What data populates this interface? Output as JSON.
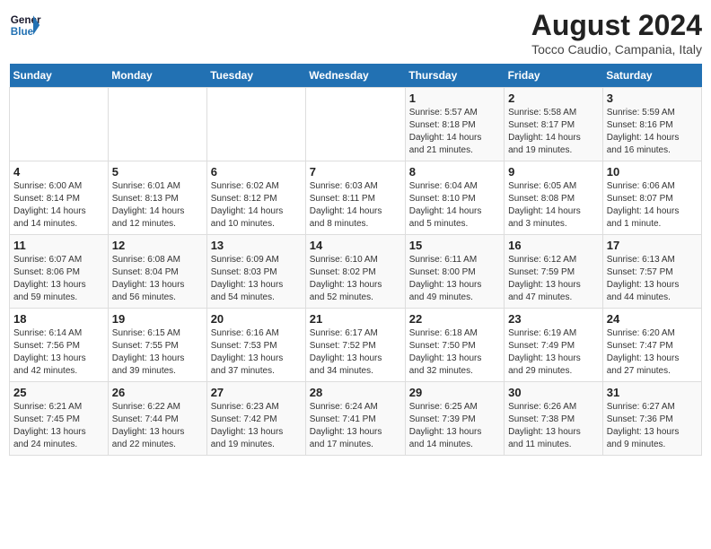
{
  "header": {
    "logo_line1": "General",
    "logo_line2": "Blue",
    "month": "August 2024",
    "location": "Tocco Caudio, Campania, Italy"
  },
  "weekdays": [
    "Sunday",
    "Monday",
    "Tuesday",
    "Wednesday",
    "Thursday",
    "Friday",
    "Saturday"
  ],
  "weeks": [
    [
      {
        "day": "",
        "info": ""
      },
      {
        "day": "",
        "info": ""
      },
      {
        "day": "",
        "info": ""
      },
      {
        "day": "",
        "info": ""
      },
      {
        "day": "1",
        "info": "Sunrise: 5:57 AM\nSunset: 8:18 PM\nDaylight: 14 hours\nand 21 minutes."
      },
      {
        "day": "2",
        "info": "Sunrise: 5:58 AM\nSunset: 8:17 PM\nDaylight: 14 hours\nand 19 minutes."
      },
      {
        "day": "3",
        "info": "Sunrise: 5:59 AM\nSunset: 8:16 PM\nDaylight: 14 hours\nand 16 minutes."
      }
    ],
    [
      {
        "day": "4",
        "info": "Sunrise: 6:00 AM\nSunset: 8:14 PM\nDaylight: 14 hours\nand 14 minutes."
      },
      {
        "day": "5",
        "info": "Sunrise: 6:01 AM\nSunset: 8:13 PM\nDaylight: 14 hours\nand 12 minutes."
      },
      {
        "day": "6",
        "info": "Sunrise: 6:02 AM\nSunset: 8:12 PM\nDaylight: 14 hours\nand 10 minutes."
      },
      {
        "day": "7",
        "info": "Sunrise: 6:03 AM\nSunset: 8:11 PM\nDaylight: 14 hours\nand 8 minutes."
      },
      {
        "day": "8",
        "info": "Sunrise: 6:04 AM\nSunset: 8:10 PM\nDaylight: 14 hours\nand 5 minutes."
      },
      {
        "day": "9",
        "info": "Sunrise: 6:05 AM\nSunset: 8:08 PM\nDaylight: 14 hours\nand 3 minutes."
      },
      {
        "day": "10",
        "info": "Sunrise: 6:06 AM\nSunset: 8:07 PM\nDaylight: 14 hours\nand 1 minute."
      }
    ],
    [
      {
        "day": "11",
        "info": "Sunrise: 6:07 AM\nSunset: 8:06 PM\nDaylight: 13 hours\nand 59 minutes."
      },
      {
        "day": "12",
        "info": "Sunrise: 6:08 AM\nSunset: 8:04 PM\nDaylight: 13 hours\nand 56 minutes."
      },
      {
        "day": "13",
        "info": "Sunrise: 6:09 AM\nSunset: 8:03 PM\nDaylight: 13 hours\nand 54 minutes."
      },
      {
        "day": "14",
        "info": "Sunrise: 6:10 AM\nSunset: 8:02 PM\nDaylight: 13 hours\nand 52 minutes."
      },
      {
        "day": "15",
        "info": "Sunrise: 6:11 AM\nSunset: 8:00 PM\nDaylight: 13 hours\nand 49 minutes."
      },
      {
        "day": "16",
        "info": "Sunrise: 6:12 AM\nSunset: 7:59 PM\nDaylight: 13 hours\nand 47 minutes."
      },
      {
        "day": "17",
        "info": "Sunrise: 6:13 AM\nSunset: 7:57 PM\nDaylight: 13 hours\nand 44 minutes."
      }
    ],
    [
      {
        "day": "18",
        "info": "Sunrise: 6:14 AM\nSunset: 7:56 PM\nDaylight: 13 hours\nand 42 minutes."
      },
      {
        "day": "19",
        "info": "Sunrise: 6:15 AM\nSunset: 7:55 PM\nDaylight: 13 hours\nand 39 minutes."
      },
      {
        "day": "20",
        "info": "Sunrise: 6:16 AM\nSunset: 7:53 PM\nDaylight: 13 hours\nand 37 minutes."
      },
      {
        "day": "21",
        "info": "Sunrise: 6:17 AM\nSunset: 7:52 PM\nDaylight: 13 hours\nand 34 minutes."
      },
      {
        "day": "22",
        "info": "Sunrise: 6:18 AM\nSunset: 7:50 PM\nDaylight: 13 hours\nand 32 minutes."
      },
      {
        "day": "23",
        "info": "Sunrise: 6:19 AM\nSunset: 7:49 PM\nDaylight: 13 hours\nand 29 minutes."
      },
      {
        "day": "24",
        "info": "Sunrise: 6:20 AM\nSunset: 7:47 PM\nDaylight: 13 hours\nand 27 minutes."
      }
    ],
    [
      {
        "day": "25",
        "info": "Sunrise: 6:21 AM\nSunset: 7:45 PM\nDaylight: 13 hours\nand 24 minutes."
      },
      {
        "day": "26",
        "info": "Sunrise: 6:22 AM\nSunset: 7:44 PM\nDaylight: 13 hours\nand 22 minutes."
      },
      {
        "day": "27",
        "info": "Sunrise: 6:23 AM\nSunset: 7:42 PM\nDaylight: 13 hours\nand 19 minutes."
      },
      {
        "day": "28",
        "info": "Sunrise: 6:24 AM\nSunset: 7:41 PM\nDaylight: 13 hours\nand 17 minutes."
      },
      {
        "day": "29",
        "info": "Sunrise: 6:25 AM\nSunset: 7:39 PM\nDaylight: 13 hours\nand 14 minutes."
      },
      {
        "day": "30",
        "info": "Sunrise: 6:26 AM\nSunset: 7:38 PM\nDaylight: 13 hours\nand 11 minutes."
      },
      {
        "day": "31",
        "info": "Sunrise: 6:27 AM\nSunset: 7:36 PM\nDaylight: 13 hours\nand 9 minutes."
      }
    ]
  ]
}
